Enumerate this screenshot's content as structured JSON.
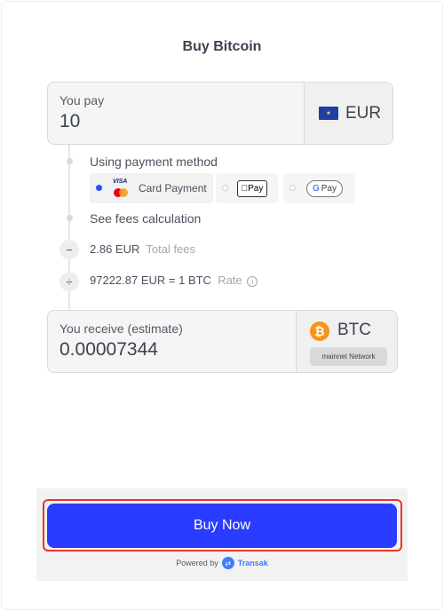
{
  "title": "Buy Bitcoin",
  "pay": {
    "label": "You pay",
    "value": "10",
    "currency": "EUR",
    "flag_icon": "eu-flag-icon"
  },
  "payment_method": {
    "label": "Using payment method",
    "options": [
      {
        "label": "Card Payment",
        "icon": "visa-mastercard-icon",
        "selected": true
      },
      {
        "label": "Pay",
        "icon": "apple-pay-icon",
        "selected": false
      },
      {
        "label": "Pay",
        "icon": "google-pay-icon",
        "selected": false
      }
    ],
    "visa_text": "VISA"
  },
  "fees_link": "See fees calculation",
  "fees": {
    "amount": "2.86 EUR",
    "label": "Total fees",
    "operator": "−"
  },
  "rate": {
    "text": "97222.87 EUR = 1 BTC",
    "label": "Rate",
    "operator": "÷"
  },
  "receive": {
    "label": "You receive (estimate)",
    "value": "0.00007344",
    "currency": "BTC",
    "network": "mainnet Network",
    "coin_icon": "bitcoin-icon"
  },
  "buy_button": "Buy Now",
  "powered_by": {
    "prefix": "Powered by",
    "brand": "Transak"
  },
  "colors": {
    "primary": "#2a3cff",
    "highlight": "#e8362a",
    "bitcoin": "#f7931a"
  }
}
